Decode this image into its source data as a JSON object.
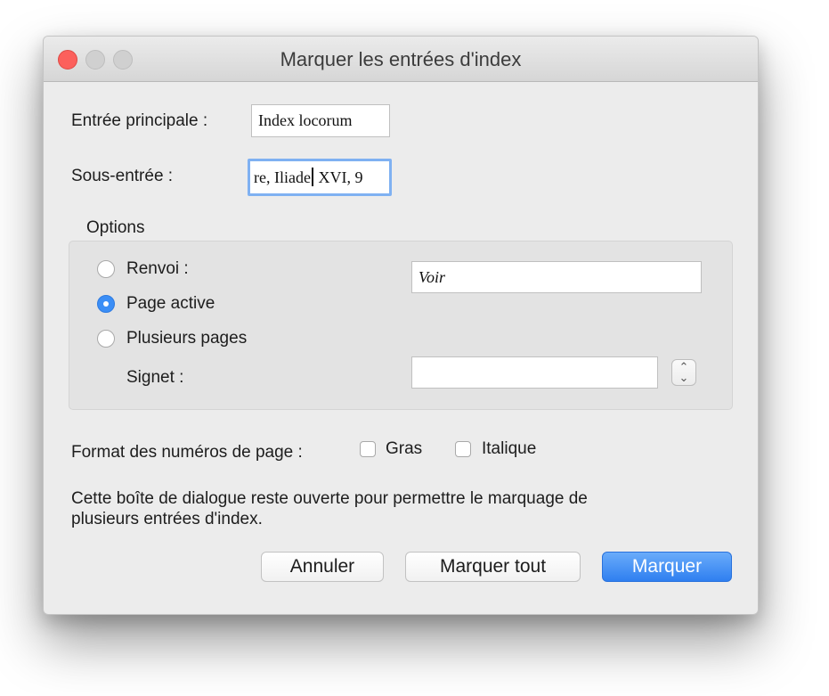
{
  "window": {
    "title": "Marquer les entrées d'index"
  },
  "main_entry": {
    "label": "Entrée principale :",
    "value": "Index locorum"
  },
  "sub_entry": {
    "label": "Sous-entrée :",
    "value_before_caret": "re, Iliade",
    "value_after_caret": " XVI, 9"
  },
  "options": {
    "label": "Options",
    "cross_reference": {
      "label": "Renvoi :",
      "selected": false,
      "value": "Voir"
    },
    "current_page": {
      "label": "Page active",
      "selected": true
    },
    "page_range": {
      "label": "Plusieurs pages",
      "selected": false
    },
    "bookmark": {
      "label": "Signet :",
      "value": ""
    }
  },
  "page_number_format": {
    "label": "Format des numéros de page :",
    "bold": {
      "label": "Gras",
      "checked": false
    },
    "italic": {
      "label": "Italique",
      "checked": false
    }
  },
  "info_text_line1": "Cette boîte de dialogue reste ouverte pour permettre le marquage de",
  "info_text_line2": "plusieurs entrées d'index.",
  "buttons": {
    "cancel": "Annuler",
    "mark_all": "Marquer tout",
    "mark": "Marquer"
  },
  "colors": {
    "accent": "#3b8ef6",
    "close": "#fc605c",
    "focus_ring": "#7fb1f2"
  },
  "icons": {
    "stepper": "chevron-up-down-icon"
  }
}
